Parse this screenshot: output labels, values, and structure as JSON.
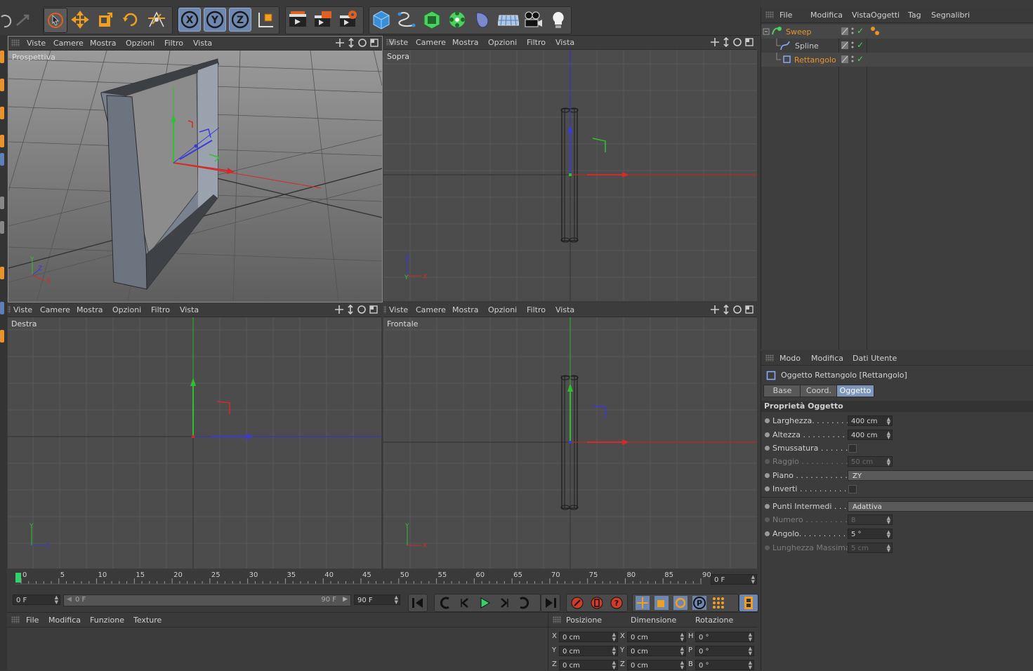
{
  "viewport_menu": [
    "Viste",
    "Camere",
    "Mostra",
    "Opzioni",
    "Filtro",
    "Vista"
  ],
  "viewports": {
    "perspective": "Prospettiva",
    "top": "Sopra",
    "right": "Destra",
    "front": "Frontale"
  },
  "toolbar_icons": [
    "undo-icon",
    "redo-icon",
    "live-selection-icon",
    "move-icon",
    "scale-icon",
    "rotate-icon",
    "recent-tools-icon",
    "x-axis-lock-icon",
    "y-axis-lock-icon",
    "z-axis-lock-icon",
    "coordinate-system-icon",
    "render-view-icon",
    "render-picture-viewer-icon",
    "render-settings-icon",
    "cube-primitive-icon",
    "spline-pen-icon",
    "subdivision-surface-icon",
    "cloner-icon",
    "deformer-icon",
    "floor-environment-icon",
    "camera-icon",
    "light-icon"
  ],
  "axis_letters": {
    "x": "X",
    "y": "Y",
    "z": "Z"
  },
  "timeline": {
    "ticks": [
      "0",
      "5",
      "10",
      "15",
      "20",
      "25",
      "30",
      "35",
      "40",
      "45",
      "50",
      "55",
      "60",
      "65",
      "70",
      "75",
      "80",
      "85",
      "90"
    ],
    "current_frame": "0 F",
    "start_frame": "0 F",
    "range_start": "0 F",
    "range_end": "90 F",
    "end_frame": "90 F"
  },
  "material_manager": {
    "menu": [
      "File",
      "Modifica",
      "Funzione",
      "Texture"
    ]
  },
  "coordinates": {
    "headers": [
      "Posizione",
      "Dimensione",
      "Rotazione"
    ],
    "rows": [
      {
        "pos_axis": "X",
        "pos": "0 cm",
        "size_axis": "X",
        "size": "0 cm",
        "rot_axis": "H",
        "rot": "0 °"
      },
      {
        "pos_axis": "Y",
        "pos": "0 cm",
        "size_axis": "Y",
        "size": "0 cm",
        "rot_axis": "P",
        "rot": "0 °"
      },
      {
        "pos_axis": "Z",
        "pos": "0 cm",
        "size_axis": "Z",
        "size": "0 cm",
        "rot_axis": "B",
        "rot": "0 °"
      }
    ]
  },
  "object_manager": {
    "menu": [
      "File",
      "Modifica",
      "Vista",
      "Oggetti",
      "Tag",
      "Segnalibri"
    ],
    "objects": [
      {
        "name": "Sweep",
        "color": "#e8932c"
      },
      {
        "name": "Spline",
        "color": "#c8c8c8"
      },
      {
        "name": "Rettangolo",
        "color": "#e8932c"
      }
    ],
    "check": "✓"
  },
  "attribute_manager": {
    "menu": [
      "Modo",
      "Modifica",
      "Dati Utente"
    ],
    "object_title": "Oggetto Rettangolo [Rettangolo]",
    "tabs": [
      "Base",
      "Coord.",
      "Oggetto"
    ],
    "section": "Proprietà Oggetto",
    "properties": [
      {
        "label": "Larghezza. . . . . . . . .",
        "value": "400 cm",
        "type": "field",
        "enabled": true
      },
      {
        "label": "Altezza . . . . . . . . . . .",
        "value": "400 cm",
        "type": "field",
        "enabled": true
      },
      {
        "label": "Smussatura . . . . . . .",
        "value": "",
        "type": "check",
        "enabled": true
      },
      {
        "label": "Raggio . . . . . . . . . . . .",
        "value": "50 cm",
        "type": "field",
        "enabled": false
      },
      {
        "label": "Piano . . . . . . . . . . . . .",
        "value": "ZY",
        "type": "drop",
        "enabled": true
      },
      {
        "label": "Inverti . . . . . . . . . . . .",
        "value": "",
        "type": "check",
        "enabled": true
      },
      {
        "label": "Punti Intermedi . . . .",
        "value": "Adattiva",
        "type": "drop",
        "enabled": true
      },
      {
        "label": "Numero . . . . . . . . . . .",
        "value": "8",
        "type": "field",
        "enabled": false
      },
      {
        "label": "Angolo. . . . . . . . . . . .",
        "value": "5 °",
        "type": "field",
        "enabled": true
      },
      {
        "label": "Lunghezza Massima",
        "value": "5 cm",
        "type": "field",
        "enabled": false
      }
    ]
  },
  "colors": {
    "axis_x": "#d42a2a",
    "axis_y": "#2fbf2f",
    "axis_z": "#3a3ad8",
    "accent": "#7d96bd",
    "highlight": "#e8932c"
  }
}
